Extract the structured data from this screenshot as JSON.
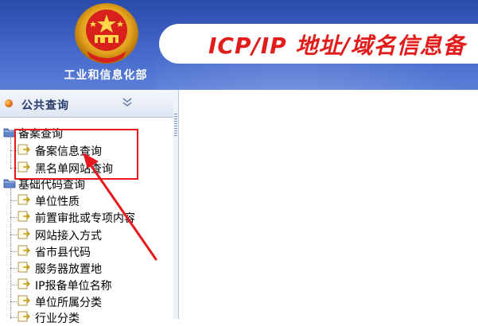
{
  "header": {
    "ministry_name": "工业和信息化部",
    "banner_title": "ICP/IP 地址/域名信息备",
    "banner_color": "#e21b1b"
  },
  "sidebar": {
    "title": "公共查询",
    "groups": [
      {
        "label": "备案查询",
        "items": [
          "备案信息查询",
          "黑名单网站查询"
        ]
      },
      {
        "label": "基础代码查询",
        "items": [
          "单位性质",
          "前置审批或专项内容",
          "网站接入方式",
          "省市县代码",
          "服务器放置地",
          "IP报备单位名称",
          "单位所属分类",
          "行业分类"
        ]
      }
    ]
  },
  "annotation": {
    "highlight_color": "#e8171d"
  }
}
